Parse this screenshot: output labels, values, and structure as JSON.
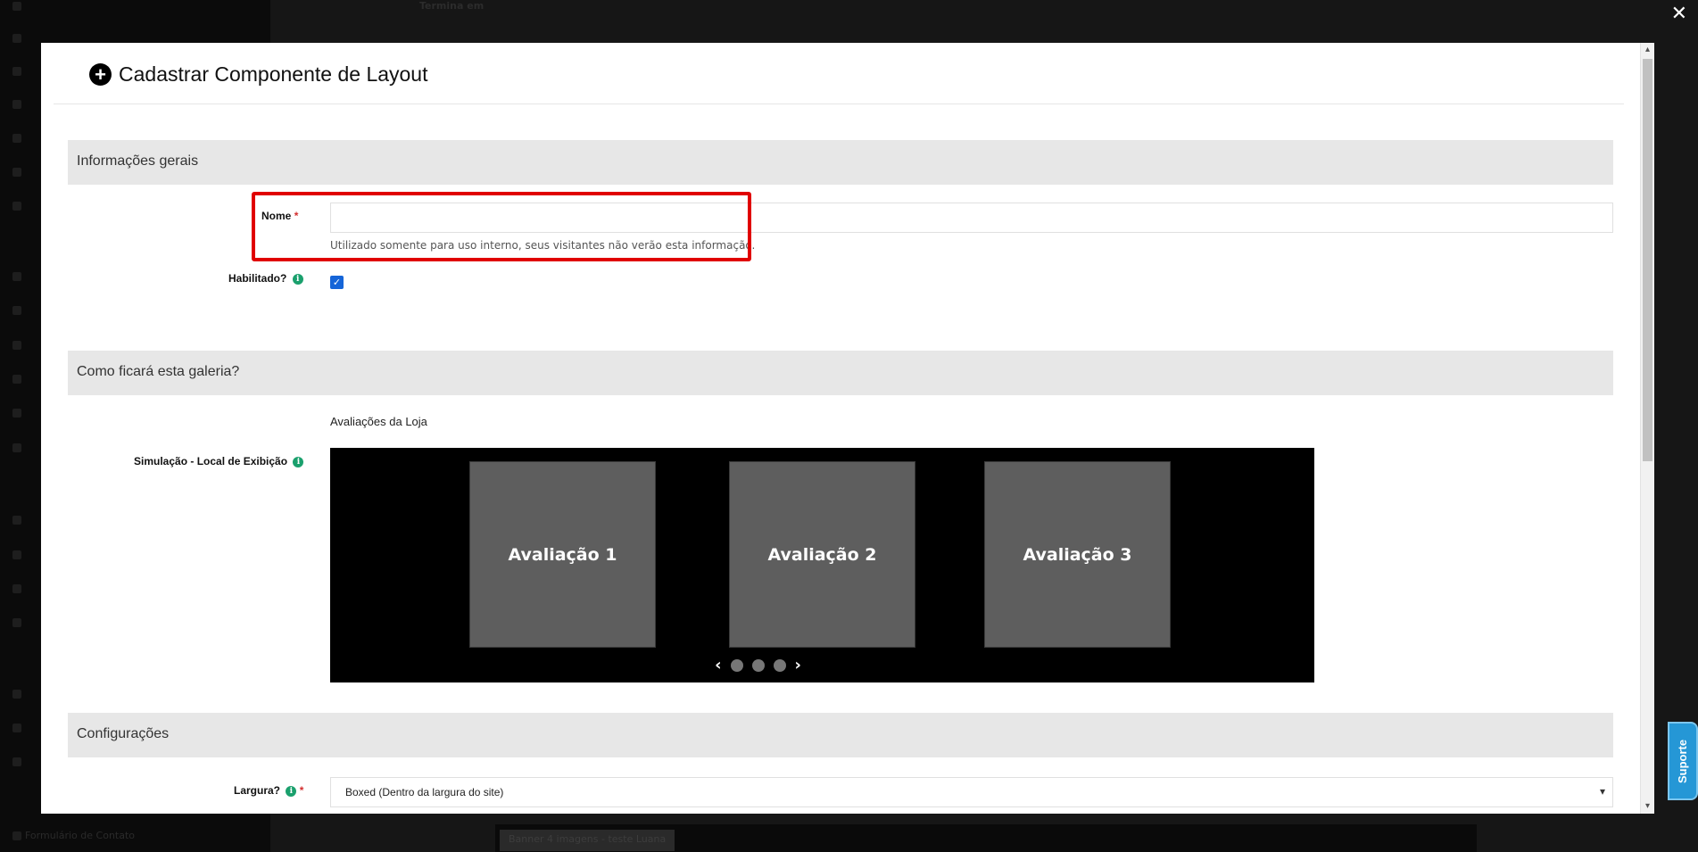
{
  "modal": {
    "title": "Cadastrar Componente de Layout",
    "sections": {
      "general": "Informações gerais",
      "preview": "Como ficará esta galeria?",
      "settings": "Configurações"
    },
    "fields": {
      "name_label": "Nome",
      "name_required": "*",
      "name_value": "",
      "name_help": "Utilizado somente para uso interno, seus visitantes não verão esta informação.",
      "enabled_label": "Habilitado?",
      "enabled_checked": true,
      "gallery_name": "Avaliações da Loja",
      "simulation_label": "Simulação - Local de Exibição",
      "width_label": "Largura?",
      "width_required": "*",
      "width_value": "Boxed (Dentro da largura do site)"
    },
    "simulation": {
      "cards": [
        "Avaliação 1",
        "Avaliação 2",
        "Avaliação 3"
      ],
      "dots": 3
    }
  },
  "info_icon_glyph": "i",
  "close_glyph": "✕",
  "support_label": "Suporte",
  "background": {
    "bottom_chip": "Banner 4 imagens - teste Luana",
    "top_label": "Termina em",
    "sidebar_footer": "Formulário de Contato"
  },
  "colors": {
    "highlight": "#e00000",
    "section_bg": "#e7e7e7",
    "checkbox": "#1565d8",
    "info": "#1aa06d",
    "support": "#2597d6"
  }
}
